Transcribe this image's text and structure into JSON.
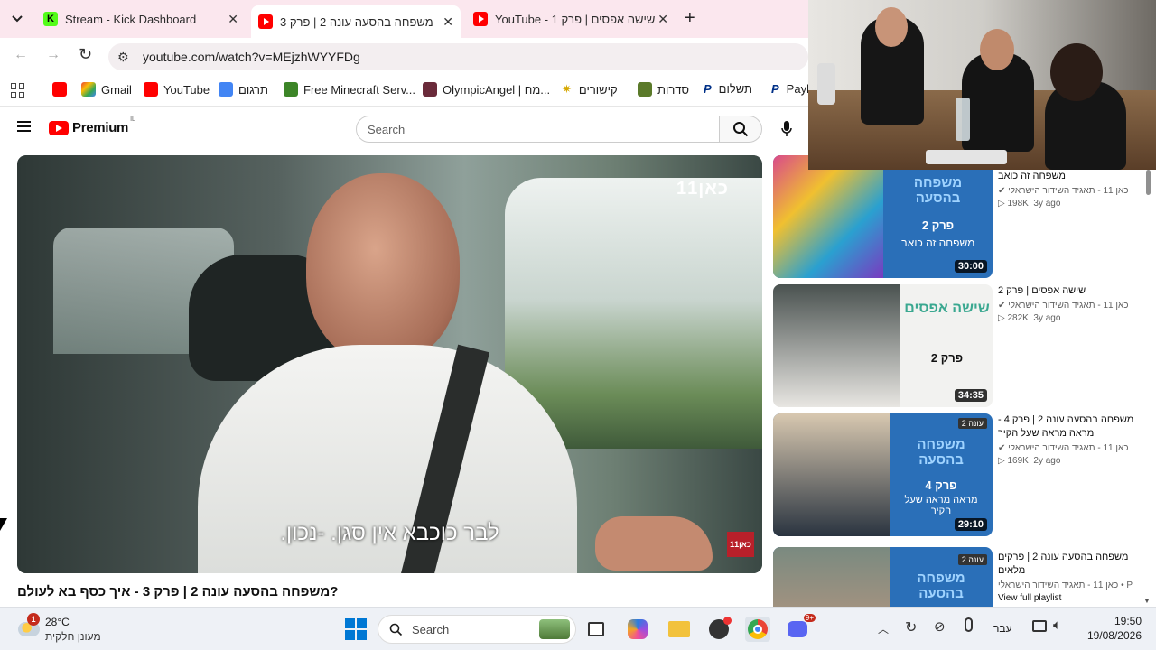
{
  "tabs": [
    {
      "title": "Stream - Kick Dashboard",
      "color": "#53fc18"
    },
    {
      "title": "משפחה בהסעה עונה 2 | פרק 3",
      "color": "#ff0000"
    },
    {
      "title": "YouTube - 1 שישה אפסים | פרק",
      "color": "#ff0000"
    }
  ],
  "address": "youtube.com/watch?v=MEjzhWYYFDg",
  "bookmarks": [
    {
      "label": "",
      "icon": "youtube-icon"
    },
    {
      "label": "Gmail",
      "icon": "gmail-icon"
    },
    {
      "label": "YouTube",
      "icon": "youtube-icon"
    },
    {
      "label": "תרגום",
      "icon": "translate-icon"
    },
    {
      "label": "Free Minecraft Serv...",
      "icon": "minecraft-icon"
    },
    {
      "label": "OlympicAngel | מח...",
      "icon": "avatar-icon"
    },
    {
      "label": "קישורים",
      "icon": "star-icon"
    },
    {
      "label": "סדרות",
      "icon": "tv-icon"
    },
    {
      "label": "תשלום",
      "icon": "paypal-icon"
    },
    {
      "label": "Payl",
      "icon": "paypal-icon"
    }
  ],
  "youtube": {
    "logo": "Premium",
    "logo_region": "IL",
    "search_placeholder": "Search"
  },
  "player": {
    "caption": "לבר כוכבא אין סגן. -נכון.",
    "watermark": "כאן11",
    "corner_logo": "כאן11"
  },
  "video_title": "משפחה בהסעה עונה 2 | פרק 3 - איך כסף בא לעולם?",
  "recommendations": [
    {
      "title": "משפחה זה כואב",
      "channel": "כאן 11 - תאגיד השידור הישראלי",
      "views": "198K",
      "age": "3y ago",
      "duration": "30:00",
      "thumb_text": "פרק 2",
      "thumb_sub": "משפחה זה כואב"
    },
    {
      "title": "שישה אפסים | פרק 2",
      "channel": "כאן 11 - תאגיד השידור הישראלי",
      "views": "282K",
      "age": "3y ago",
      "duration": "34:35",
      "thumb_text": "פרק 2",
      "thumb_sub": "שישה אפסים"
    },
    {
      "title": "משפחה בהסעה עונה 2 | פרק 4 - מראה מראה שעל הקיר",
      "channel": "כאן 11 - תאגיד השידור הישראלי",
      "views": "169K",
      "age": "2y ago",
      "duration": "29:10",
      "thumb_text": "פרק 4",
      "thumb_sub": "מראה מראה שעל הקיר"
    },
    {
      "title": "משפחה בהסעה עונה 2 | פרקים מלאים",
      "channel": "כאן 11 - תאגיד השידור הישראלי • P",
      "views": "",
      "age": "",
      "duration": "",
      "thumb_text": "",
      "thumb_sub": "",
      "extra": "View full playlist"
    }
  ],
  "thumb_badges": {
    "season": "עונה 2",
    "brand": "משפחה בהסעה"
  },
  "taskbar": {
    "weather_temp": "28°C",
    "weather_desc": "מעונן חלקית",
    "weather_badge": "1",
    "search_label": "Search",
    "lang": "עבר",
    "time": "19:50",
    "date": "19/08/2026",
    "discord_badge": "9+"
  },
  "colors": {
    "youtube_red": "#ff0000",
    "tabstrip": "#fbe7ee",
    "kan_blue": "#2a6fb8"
  }
}
